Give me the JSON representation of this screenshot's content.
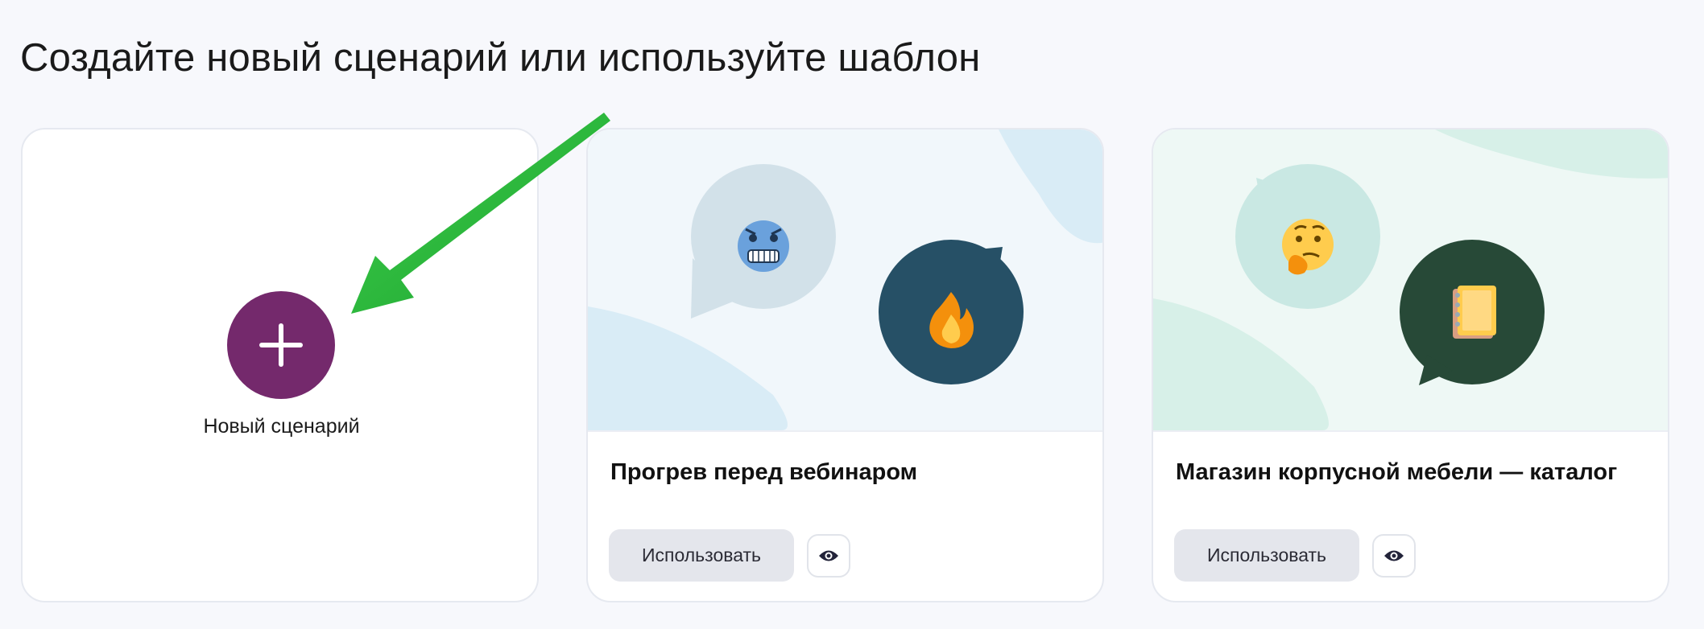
{
  "header": {
    "title": "Создайте новый сценарий или используйте шаблон"
  },
  "new_scenario": {
    "label": "Новый сценарий",
    "icon": "plus-icon",
    "color": "#74296c"
  },
  "templates": [
    {
      "title": "Прогрев перед вебинаром",
      "use_label": "Использовать",
      "preview_icon": "eye-icon",
      "emojis": [
        "cold-face-emoji",
        "fire-emoji"
      ],
      "accent": "#265066"
    },
    {
      "title": "Магазин корпусной мебели — каталог",
      "use_label": "Использовать",
      "preview_icon": "eye-icon",
      "emojis": [
        "thinking-face-emoji",
        "notebook-emoji"
      ],
      "accent": "#274937"
    }
  ],
  "annotation": {
    "arrow_color": "#2dbb3c"
  }
}
